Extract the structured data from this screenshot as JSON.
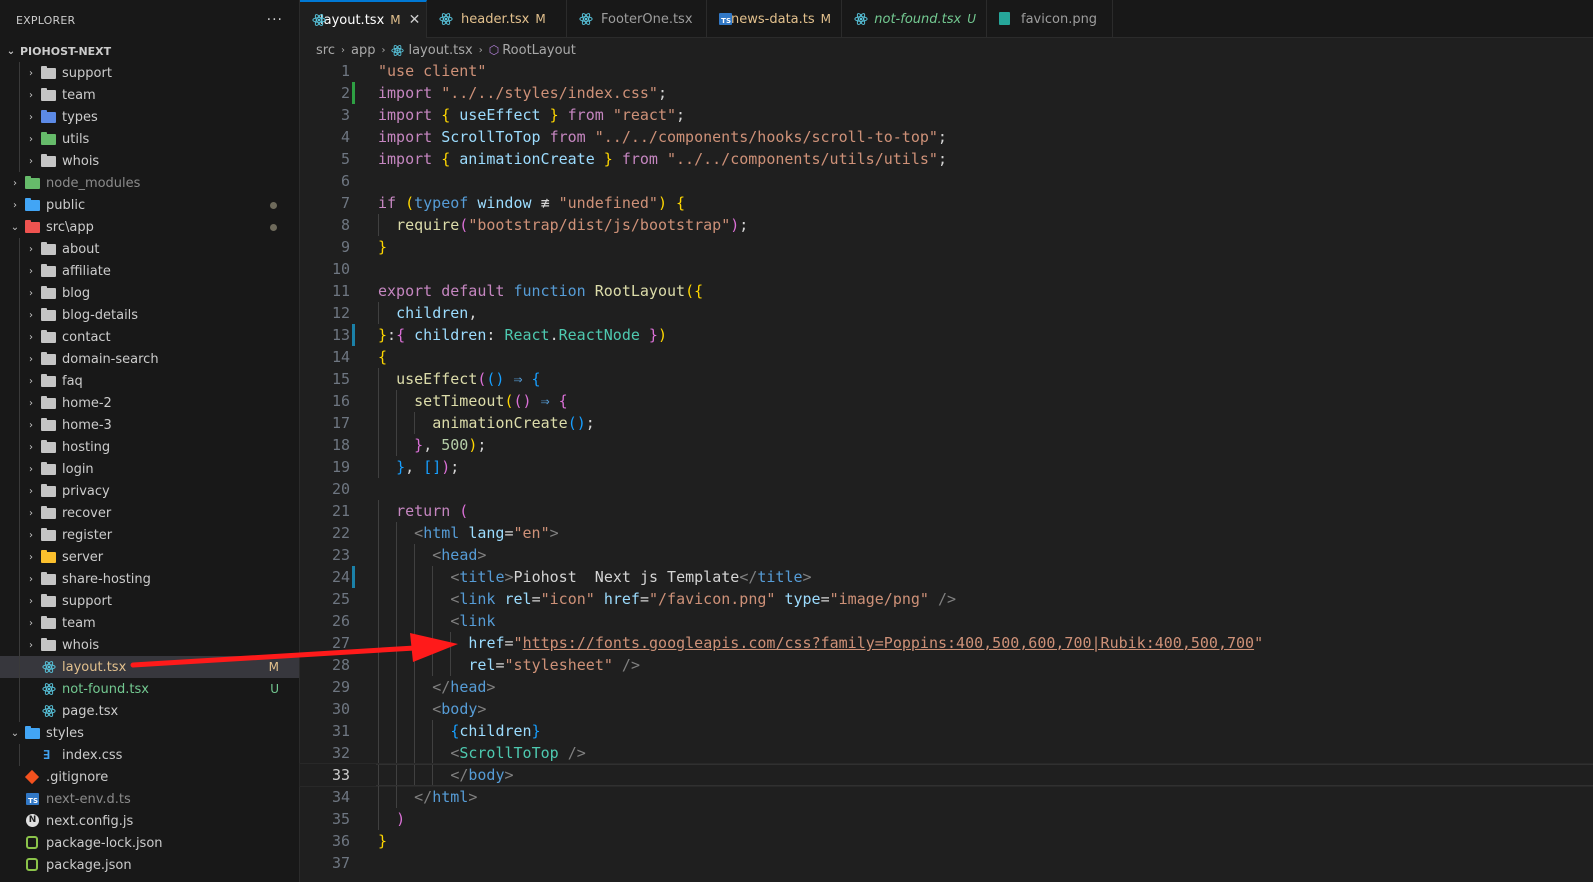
{
  "explorer": {
    "title": "EXPLORER",
    "more_actions": "···",
    "project": "PIOHOST-NEXT",
    "tree": [
      {
        "label": "support",
        "kind": "folder",
        "depth": 1,
        "color": "grey",
        "open": false
      },
      {
        "label": "team",
        "kind": "folder",
        "depth": 1,
        "color": "grey",
        "open": false
      },
      {
        "label": "types",
        "kind": "folder",
        "depth": 1,
        "color": "types",
        "open": false
      },
      {
        "label": "utils",
        "kind": "folder",
        "depth": 1,
        "color": "green",
        "open": false
      },
      {
        "label": "whois",
        "kind": "folder",
        "depth": 1,
        "color": "grey",
        "open": false
      },
      {
        "label": "node_modules",
        "kind": "folder",
        "depth": 0,
        "color": "green",
        "open": false,
        "dim": true
      },
      {
        "label": "public",
        "kind": "folder",
        "depth": 0,
        "color": "blue",
        "open": false,
        "dot": true
      },
      {
        "label": "src\\app",
        "kind": "folder",
        "depth": 0,
        "color": "red",
        "open": true,
        "dot": true
      },
      {
        "label": "about",
        "kind": "folder",
        "depth": 1,
        "color": "grey",
        "open": false
      },
      {
        "label": "affiliate",
        "kind": "folder",
        "depth": 1,
        "color": "grey",
        "open": false
      },
      {
        "label": "blog",
        "kind": "folder",
        "depth": 1,
        "color": "grey",
        "open": false
      },
      {
        "label": "blog-details",
        "kind": "folder",
        "depth": 1,
        "color": "grey",
        "open": false
      },
      {
        "label": "contact",
        "kind": "folder",
        "depth": 1,
        "color": "grey",
        "open": false
      },
      {
        "label": "domain-search",
        "kind": "folder",
        "depth": 1,
        "color": "grey",
        "open": false
      },
      {
        "label": "faq",
        "kind": "folder",
        "depth": 1,
        "color": "grey",
        "open": false
      },
      {
        "label": "home-2",
        "kind": "folder",
        "depth": 1,
        "color": "grey",
        "open": false
      },
      {
        "label": "home-3",
        "kind": "folder",
        "depth": 1,
        "color": "grey",
        "open": false
      },
      {
        "label": "hosting",
        "kind": "folder",
        "depth": 1,
        "color": "grey",
        "open": false
      },
      {
        "label": "login",
        "kind": "folder",
        "depth": 1,
        "color": "grey",
        "open": false
      },
      {
        "label": "privacy",
        "kind": "folder",
        "depth": 1,
        "color": "grey",
        "open": false
      },
      {
        "label": "recover",
        "kind": "folder",
        "depth": 1,
        "color": "grey",
        "open": false
      },
      {
        "label": "register",
        "kind": "folder",
        "depth": 1,
        "color": "grey",
        "open": false
      },
      {
        "label": "server",
        "kind": "folder",
        "depth": 1,
        "color": "yellow",
        "open": false
      },
      {
        "label": "share-hosting",
        "kind": "folder",
        "depth": 1,
        "color": "grey",
        "open": false
      },
      {
        "label": "support",
        "kind": "folder",
        "depth": 1,
        "color": "grey",
        "open": false
      },
      {
        "label": "team",
        "kind": "folder",
        "depth": 1,
        "color": "grey",
        "open": false
      },
      {
        "label": "whois",
        "kind": "folder",
        "depth": 1,
        "color": "grey",
        "open": false
      },
      {
        "label": "layout.tsx",
        "kind": "react",
        "depth": 1,
        "badge": "M",
        "badge_color": "#e2c08d",
        "label_color": "#e2c08d",
        "selected": true
      },
      {
        "label": "not-found.tsx",
        "kind": "react",
        "depth": 1,
        "badge": "U",
        "badge_color": "#73c991",
        "label_color": "#73c991"
      },
      {
        "label": "page.tsx",
        "kind": "react",
        "depth": 1
      },
      {
        "label": "styles",
        "kind": "folder",
        "depth": 0,
        "color": "blue",
        "open": true
      },
      {
        "label": "index.css",
        "kind": "css",
        "depth": 1
      },
      {
        "label": ".gitignore",
        "kind": "git",
        "depth": 0
      },
      {
        "label": "next-env.d.ts",
        "kind": "ts",
        "depth": 0,
        "dim": true
      },
      {
        "label": "next.config.js",
        "kind": "next",
        "depth": 0
      },
      {
        "label": "package-lock.json",
        "kind": "pkg",
        "depth": 0
      },
      {
        "label": "package.json",
        "kind": "pkg",
        "depth": 0
      }
    ]
  },
  "tabs": [
    {
      "label": "layout.tsx",
      "status": "M",
      "icon": "react-icon",
      "active": true,
      "modified": true
    },
    {
      "label": "header.tsx",
      "status": "M",
      "icon": "react-icon",
      "modified": true
    },
    {
      "label": "FooterOne.tsx",
      "status": "",
      "icon": "react-icon"
    },
    {
      "label": "news-data.ts",
      "status": "M",
      "icon": "ts-icon",
      "modified": true
    },
    {
      "label": "not-found.tsx",
      "status": "U",
      "icon": "react-icon",
      "untracked": true
    },
    {
      "label": "favicon.png",
      "status": "",
      "icon": "image-icon"
    }
  ],
  "breadcrumb": [
    "src",
    "app",
    "layout.tsx",
    "RootLayout"
  ],
  "editor": {
    "current_line": 33,
    "gutter_marks": {
      "2": "#2ea043",
      "13": "#1b81a8",
      "24": "#1b81a8"
    },
    "lines": [
      {
        "n": 1,
        "indent": 0,
        "tokens": [
          [
            "str",
            "\"use client\""
          ]
        ]
      },
      {
        "n": 2,
        "indent": 0,
        "tokens": [
          [
            "kw",
            "import "
          ],
          [
            "str",
            "\"../../styles/index.css\""
          ],
          [
            "pun",
            ";"
          ]
        ]
      },
      {
        "n": 3,
        "indent": 0,
        "tokens": [
          [
            "kw",
            "import "
          ],
          [
            "b1",
            "{ "
          ],
          [
            "var",
            "useEffect "
          ],
          [
            "b1",
            "}"
          ],
          [
            "kw",
            " from "
          ],
          [
            "str",
            "\"react\""
          ],
          [
            "pun",
            ";"
          ]
        ]
      },
      {
        "n": 4,
        "indent": 0,
        "tokens": [
          [
            "kw",
            "import "
          ],
          [
            "var",
            "ScrollToTop"
          ],
          [
            "kw",
            " from "
          ],
          [
            "str",
            "\"../../components/hooks/scroll-to-top\""
          ],
          [
            "pun",
            ";"
          ]
        ]
      },
      {
        "n": 5,
        "indent": 0,
        "tokens": [
          [
            "kw",
            "import "
          ],
          [
            "b1",
            "{ "
          ],
          [
            "var",
            "animationCreate "
          ],
          [
            "b1",
            "}"
          ],
          [
            "kw",
            " from "
          ],
          [
            "str",
            "\"../../components/utils/utils\""
          ],
          [
            "pun",
            ";"
          ]
        ]
      },
      {
        "n": 6,
        "indent": 0,
        "tokens": []
      },
      {
        "n": 7,
        "indent": 0,
        "tokens": [
          [
            "kw",
            "if "
          ],
          [
            "b1",
            "("
          ],
          [
            "kw2",
            "typeof "
          ],
          [
            "var",
            "window "
          ],
          [
            "pun",
            "≢ "
          ],
          [
            "str",
            "\"undefined\""
          ],
          [
            "b1",
            ")"
          ],
          [
            "pun",
            " "
          ],
          [
            "b1",
            "{"
          ]
        ]
      },
      {
        "n": 8,
        "indent": 1,
        "tokens": [
          [
            "fn",
            "require"
          ],
          [
            "b2",
            "("
          ],
          [
            "str",
            "\"bootstrap/dist/js/bootstrap\""
          ],
          [
            "b2",
            ")"
          ],
          [
            "pun",
            ";"
          ]
        ]
      },
      {
        "n": 9,
        "indent": 0,
        "tokens": [
          [
            "b1",
            "}"
          ]
        ]
      },
      {
        "n": 10,
        "indent": 0,
        "tokens": []
      },
      {
        "n": 11,
        "indent": 0,
        "tokens": [
          [
            "kw",
            "export "
          ],
          [
            "kw",
            "default "
          ],
          [
            "kw2",
            "function "
          ],
          [
            "fn",
            "RootLayout"
          ],
          [
            "b1",
            "({"
          ]
        ]
      },
      {
        "n": 12,
        "indent": 1,
        "tokens": [
          [
            "var",
            "children"
          ],
          [
            "pun",
            ","
          ]
        ]
      },
      {
        "n": 13,
        "indent": 0,
        "tokens": [
          [
            "b1",
            "}"
          ],
          [
            "pun",
            ":"
          ],
          [
            "b2",
            "{ "
          ],
          [
            "var",
            "children"
          ],
          [
            "pun",
            ": "
          ],
          [
            "ty",
            "React"
          ],
          [
            "pun",
            "."
          ],
          [
            "ty",
            "ReactNode"
          ],
          [
            "b2",
            " }"
          ],
          [
            "b1",
            ")"
          ]
        ]
      },
      {
        "n": 14,
        "indent": 0,
        "tokens": [
          [
            "b1",
            "{"
          ]
        ]
      },
      {
        "n": 15,
        "indent": 1,
        "tokens": [
          [
            "fn",
            "useEffect"
          ],
          [
            "b2",
            "("
          ],
          [
            "b3",
            "()"
          ],
          [
            "kw2",
            " ⇒ "
          ],
          [
            "b3",
            "{"
          ]
        ]
      },
      {
        "n": 16,
        "indent": 2,
        "tokens": [
          [
            "fn",
            "setTimeout"
          ],
          [
            "b1",
            "("
          ],
          [
            "b2",
            "()"
          ],
          [
            "kw2",
            " ⇒ "
          ],
          [
            "b2",
            "{"
          ]
        ]
      },
      {
        "n": 17,
        "indent": 3,
        "tokens": [
          [
            "fn",
            "animationCreate"
          ],
          [
            "b3",
            "()"
          ],
          [
            "pun",
            ";"
          ]
        ]
      },
      {
        "n": 18,
        "indent": 2,
        "tokens": [
          [
            "b2",
            "}"
          ],
          [
            "pun",
            ", "
          ],
          [
            "num",
            "500"
          ],
          [
            "b1",
            ")"
          ],
          [
            "pun",
            ";"
          ]
        ]
      },
      {
        "n": 19,
        "indent": 1,
        "tokens": [
          [
            "b3",
            "}"
          ],
          [
            "pun",
            ", "
          ],
          [
            "b3",
            "[]"
          ],
          [
            "b2",
            ")"
          ],
          [
            "pun",
            ";"
          ]
        ]
      },
      {
        "n": 20,
        "indent": 0,
        "tokens": []
      },
      {
        "n": 21,
        "indent": 1,
        "tokens": [
          [
            "kw",
            "return "
          ],
          [
            "b2",
            "("
          ]
        ]
      },
      {
        "n": 22,
        "indent": 2,
        "tokens": [
          [
            "ang",
            "<"
          ],
          [
            "tag",
            "html "
          ],
          [
            "attr",
            "lang"
          ],
          [
            "pun",
            "="
          ],
          [
            "str",
            "\"en\""
          ],
          [
            "ang",
            ">"
          ]
        ]
      },
      {
        "n": 23,
        "indent": 3,
        "tokens": [
          [
            "ang",
            "<"
          ],
          [
            "tag",
            "head"
          ],
          [
            "ang",
            ">"
          ]
        ]
      },
      {
        "n": 24,
        "indent": 4,
        "tokens": [
          [
            "ang",
            "<"
          ],
          [
            "tag",
            "title"
          ],
          [
            "ang",
            ">"
          ],
          [
            "pun",
            "Piohost  Next js Template"
          ],
          [
            "ang",
            "</"
          ],
          [
            "tag",
            "title"
          ],
          [
            "ang",
            ">"
          ]
        ]
      },
      {
        "n": 25,
        "indent": 4,
        "tokens": [
          [
            "ang",
            "<"
          ],
          [
            "tag",
            "link "
          ],
          [
            "attr",
            "rel"
          ],
          [
            "pun",
            "="
          ],
          [
            "str",
            "\"icon\" "
          ],
          [
            "attr",
            "href"
          ],
          [
            "pun",
            "="
          ],
          [
            "str",
            "\"/favicon.png\" "
          ],
          [
            "attr",
            "type"
          ],
          [
            "pun",
            "="
          ],
          [
            "str",
            "\"image/png\" "
          ],
          [
            "ang",
            "/>"
          ]
        ]
      },
      {
        "n": 26,
        "indent": 4,
        "tokens": [
          [
            "ang",
            "<"
          ],
          [
            "tag",
            "link"
          ]
        ]
      },
      {
        "n": 27,
        "indent": 5,
        "tokens": [
          [
            "attr",
            "href"
          ],
          [
            "pun",
            "="
          ],
          [
            "str",
            "\""
          ],
          [
            "url",
            "https://fonts.googleapis.com/css?family=Poppins:400,500,600,700|Rubik:400,500,700"
          ],
          [
            "str",
            "\""
          ]
        ]
      },
      {
        "n": 28,
        "indent": 5,
        "tokens": [
          [
            "attr",
            "rel"
          ],
          [
            "pun",
            "="
          ],
          [
            "str",
            "\"stylesheet\" "
          ],
          [
            "ang",
            "/>"
          ]
        ]
      },
      {
        "n": 29,
        "indent": 3,
        "tokens": [
          [
            "ang",
            "</"
          ],
          [
            "tag",
            "head"
          ],
          [
            "ang",
            ">"
          ]
        ]
      },
      {
        "n": 30,
        "indent": 3,
        "tokens": [
          [
            "ang",
            "<"
          ],
          [
            "tag",
            "body"
          ],
          [
            "ang",
            ">"
          ]
        ]
      },
      {
        "n": 31,
        "indent": 4,
        "tokens": [
          [
            "b3",
            "{"
          ],
          [
            "var",
            "children"
          ],
          [
            "b3",
            "}"
          ]
        ]
      },
      {
        "n": 32,
        "indent": 4,
        "tokens": [
          [
            "ang",
            "<"
          ],
          [
            "tagc",
            "ScrollToTop "
          ],
          [
            "ang",
            "/>"
          ]
        ]
      },
      {
        "n": 33,
        "indent": 4,
        "tokens": [
          [
            "ang",
            "</"
          ],
          [
            "tag",
            "body"
          ],
          [
            "ang",
            ">"
          ]
        ]
      },
      {
        "n": 34,
        "indent": 2,
        "tokens": [
          [
            "ang",
            "</"
          ],
          [
            "tag",
            "html"
          ],
          [
            "ang",
            ">"
          ]
        ]
      },
      {
        "n": 35,
        "indent": 1,
        "tokens": [
          [
            "b2",
            ")"
          ]
        ]
      },
      {
        "n": 36,
        "indent": 0,
        "tokens": [
          [
            "b1",
            "}"
          ]
        ]
      },
      {
        "n": 37,
        "indent": 0,
        "tokens": []
      }
    ]
  },
  "colors": {
    "accent": "#0078d4",
    "modified": "#e2c08d",
    "untracked": "#73c991",
    "annotation_arrow": "#ff1a1a"
  }
}
